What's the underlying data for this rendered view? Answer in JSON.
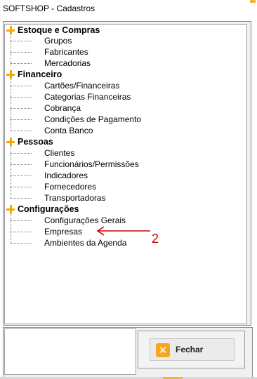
{
  "window": {
    "title": "SOFTSHOP - Cadastros"
  },
  "tree": {
    "groups": [
      {
        "label": "Estoque e Compras",
        "items": [
          "Grupos",
          "Fabricantes",
          "Mercadorias"
        ]
      },
      {
        "label": "Financeiro",
        "items": [
          "Cartões/Financeiras",
          "Categorias Financeiras",
          "Cobrança",
          "Condições de Pagamento",
          "Conta Banco"
        ]
      },
      {
        "label": "Pessoas",
        "items": [
          "Clientes",
          "Funcionários/Permissões",
          "Indicadores",
          "Fornecedores",
          "Transportadoras"
        ]
      },
      {
        "label": "Configurações",
        "items": [
          "Configurações Gerais",
          "Empresas",
          "Ambientes da Agenda"
        ]
      }
    ]
  },
  "buttons": {
    "close_label": "Fechar",
    "close_icon": "close-icon"
  },
  "annotation": {
    "number": "2",
    "color": "#d00000"
  },
  "colors": {
    "accent": "#f2a900",
    "annotation": "#d00000"
  }
}
